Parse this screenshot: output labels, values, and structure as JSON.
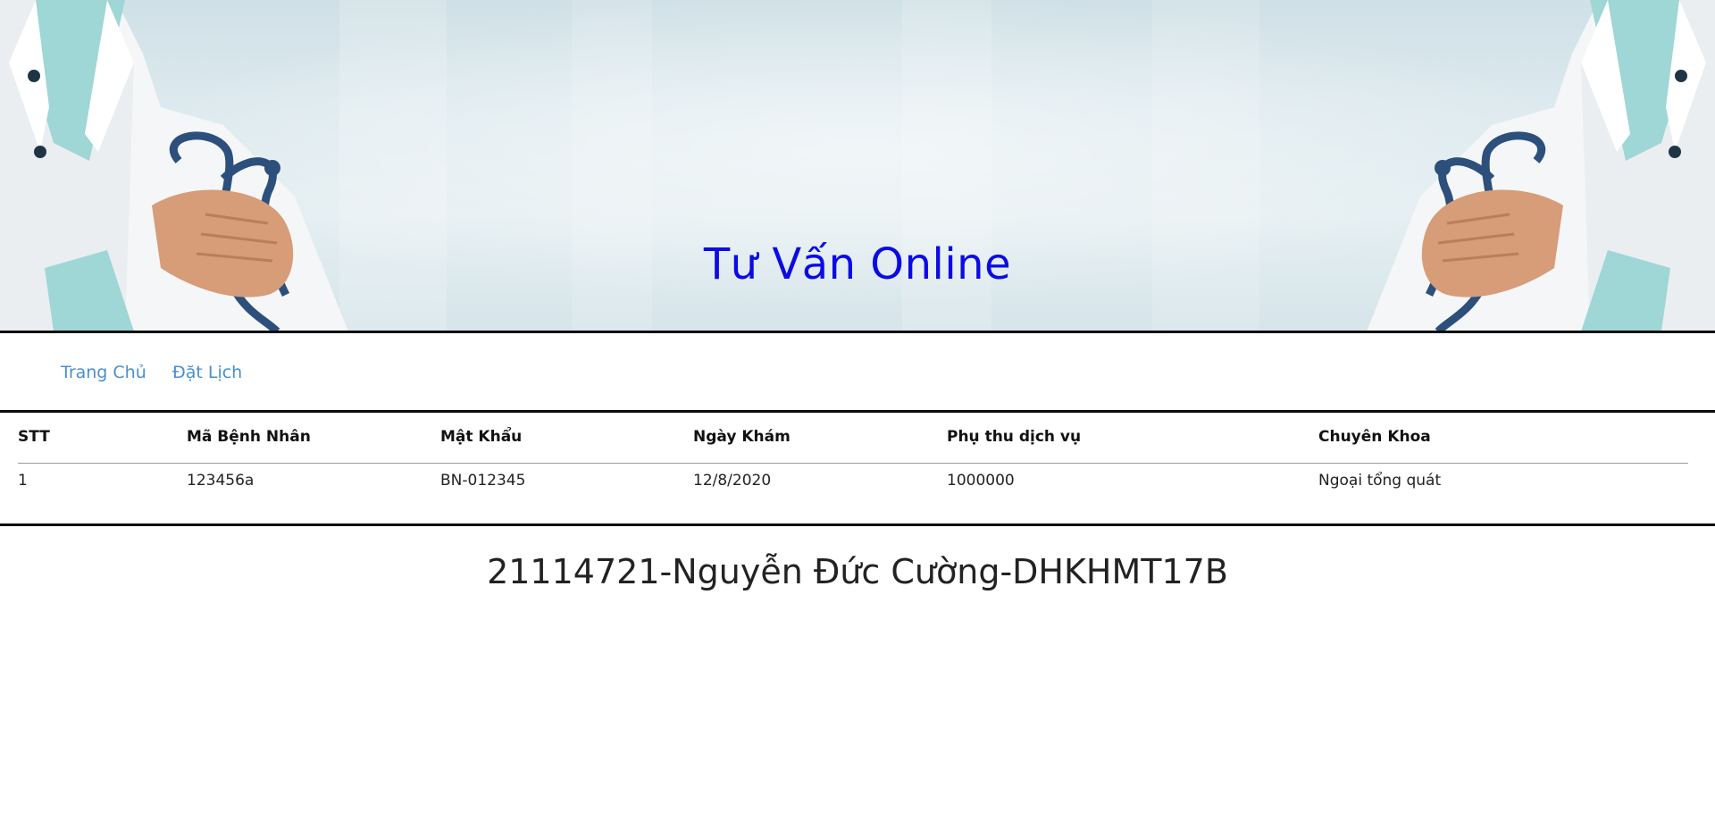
{
  "banner": {
    "title": "Tư Vấn Online"
  },
  "nav": {
    "items": [
      {
        "label": "Trang Chủ"
      },
      {
        "label": "Đặt Lịch"
      }
    ]
  },
  "table": {
    "columns": [
      "STT",
      "Mã Bệnh Nhân",
      "Mật Khẩu",
      "Ngày Khám",
      "Phụ thu dịch vụ",
      "Chuyên Khoa"
    ],
    "rows": [
      [
        "1",
        "123456a",
        "BN-012345",
        "12/8/2020",
        "1000000",
        "Ngoại tổng quát"
      ]
    ]
  },
  "footer": {
    "signature": "21114721-Nguyễn Đức Cường-DHKHMT17B"
  },
  "colors": {
    "title": "#0b0be6",
    "nav_link": "#4a8fcf",
    "rule": "#0c0c0c"
  }
}
